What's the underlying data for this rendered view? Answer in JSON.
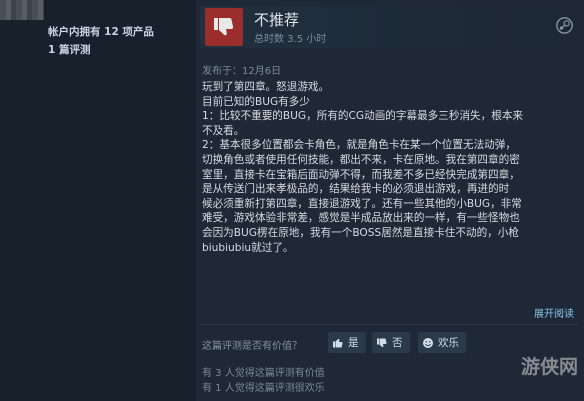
{
  "sidebar": {
    "owned_games": "帐户内拥有 12 项产品",
    "review_count": "1 篇评测"
  },
  "review": {
    "verdict": "不推荐",
    "hours": "总时数 3.5 小时",
    "posted": "发布于：12月6日",
    "lines": [
      "玩到了第四章。怒退游戏。",
      "目前已知的BUG有多少",
      "1：比较不重要的BUG，所有的CG动画的字幕最多三秒消失，根本来",
      "不及看。",
      "2：基本很多位置都会卡角色，就是角色卡在某一个位置无法动弹，",
      "切换角色或者使用任何技能，都出不来，卡在原地。我在第四章的密",
      "室里，直接卡在宝箱后面动弹不得，而我差不多已经快完成第四章，",
      "是从传送门出来孝极品的，结果给我卡的必须退出游戏，再进的时",
      "候必须重新打第四章，直接退游戏了。还有一些其他的小BUG，非常",
      "难受，游戏体验非常差，感觉是半成品放出来的一样，有一些怪物也",
      "会因为BUG楞在原地，我有一个BOSS居然是直接卡住不动的，小枪",
      "biubiubiu就过了。"
    ],
    "expand_label": "展开阅读"
  },
  "feedback": {
    "question": "这篇评测是否有价值？",
    "yes_label": "是",
    "no_label": "否",
    "funny_label": "欢乐",
    "helpful_stat": "有 3 人觉得这篇评测有价值",
    "funny_stat": "有 1 人觉得这篇评测很欢乐"
  },
  "watermark": "游侠网",
  "colors": {
    "thumb_bg": "#9c2d2d",
    "link": "#8bc7ec"
  },
  "icons": {
    "verdict": "thumbs-down-icon",
    "platform": "steam-icon",
    "yes": "thumbs-up-icon",
    "no": "thumbs-down-icon",
    "funny": "smiley-icon"
  }
}
